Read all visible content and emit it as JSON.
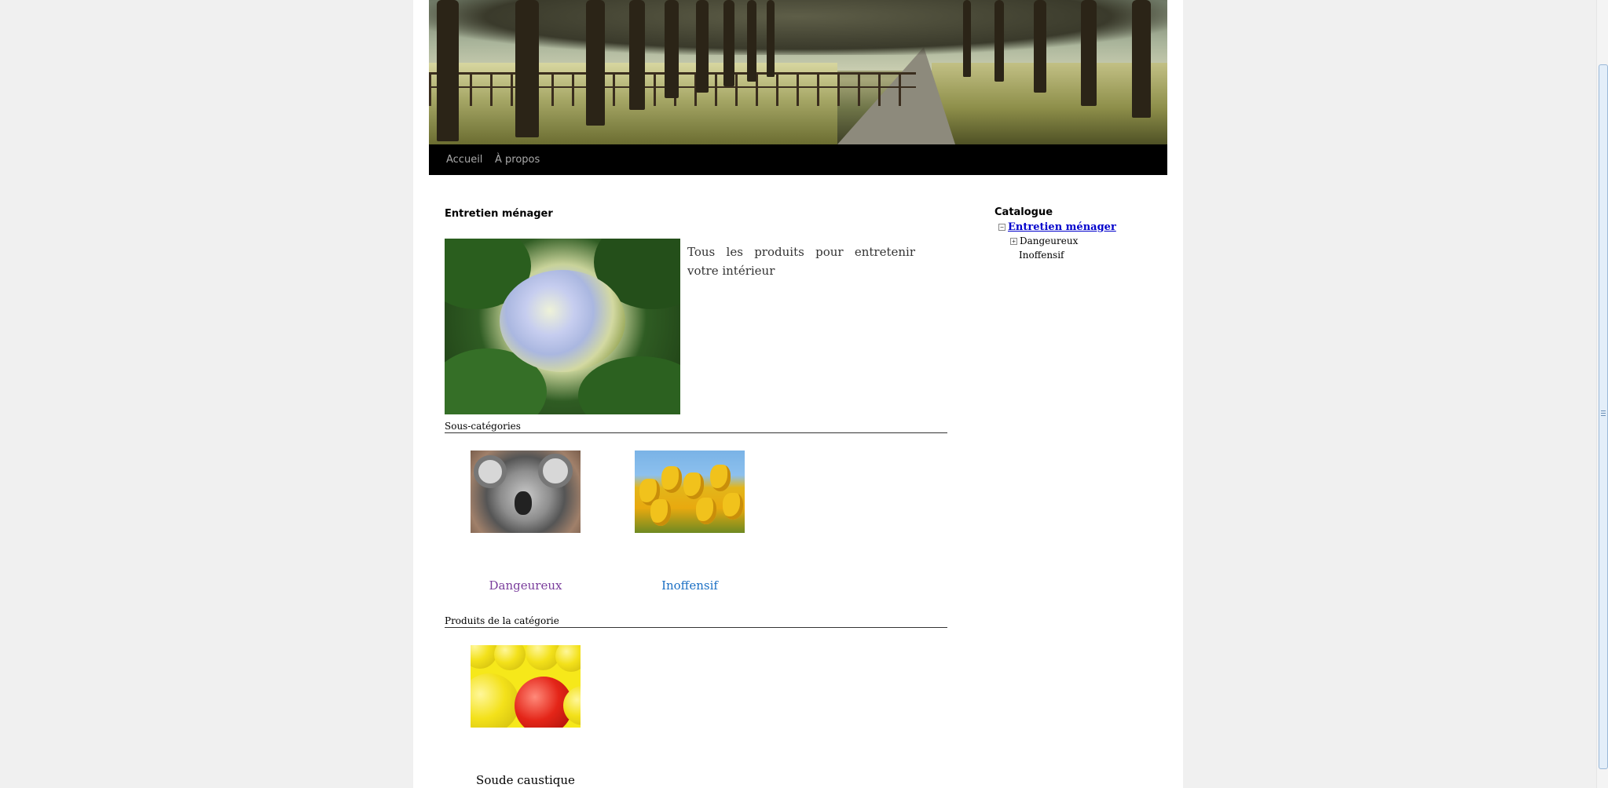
{
  "nav": {
    "items": [
      {
        "label": "Accueil"
      },
      {
        "label": "À propos"
      }
    ]
  },
  "category": {
    "title": "Entretien ménager",
    "description": "Tous les produits pour entretenir votre intérieur",
    "image_icon": "hydrangea-photo"
  },
  "subcategories": {
    "heading": "Sous-catégories",
    "items": [
      {
        "label": "Dangeureux",
        "image_icon": "koala-photo",
        "color": "#7a3d9c"
      },
      {
        "label": "Inoffensif",
        "image_icon": "tulips-photo",
        "color": "#1a6fc4"
      }
    ]
  },
  "products": {
    "heading": "Produits de la catégorie",
    "items": [
      {
        "label": "Soude caustique",
        "image_icon": "smiley-balls-photo"
      }
    ]
  },
  "sidebar": {
    "title": "Catalogue",
    "tree": {
      "root": {
        "label": "Entretien ménager",
        "toggle": "⊟"
      },
      "children": [
        {
          "label": "Dangeureux",
          "toggle": "⊞"
        },
        {
          "label": "Inoffensif"
        }
      ]
    }
  },
  "colors": {
    "link_visited": "#7a3d9c",
    "link": "#1a6fc4",
    "tree_link": "#0000cc",
    "navbar_bg": "#000000"
  }
}
